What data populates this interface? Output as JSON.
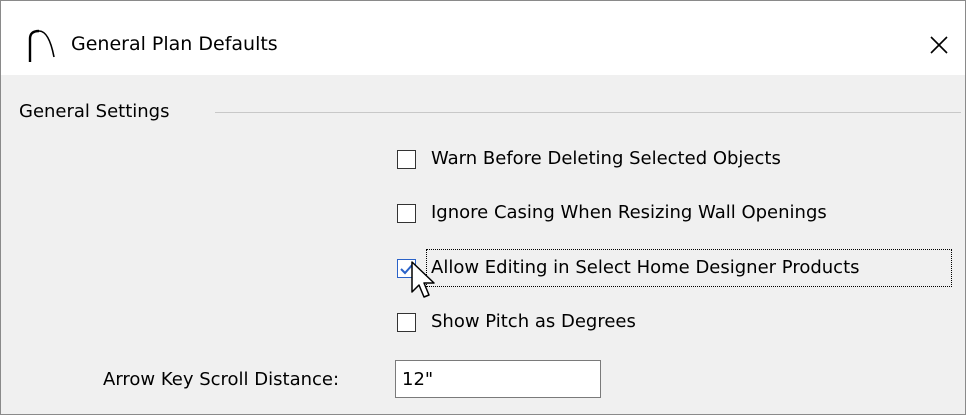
{
  "window": {
    "title": "General Plan Defaults",
    "close_icon": "close-icon"
  },
  "group": {
    "label": "General Settings"
  },
  "checkboxes": [
    {
      "label": "Warn Before Deleting Selected Objects",
      "checked": false
    },
    {
      "label": "Ignore Casing When Resizing Wall Openings",
      "checked": false
    },
    {
      "label": "Allow Editing in Select Home Designer Products",
      "checked": true
    },
    {
      "label": "Show Pitch as Degrees",
      "checked": false
    }
  ],
  "scroll_distance": {
    "label": "Arrow Key Scroll Distance:",
    "value": "12\""
  },
  "colors": {
    "check_accent": "#2a62c8",
    "dialog_background": "#f0f0f0",
    "title_background": "#ffffff"
  }
}
